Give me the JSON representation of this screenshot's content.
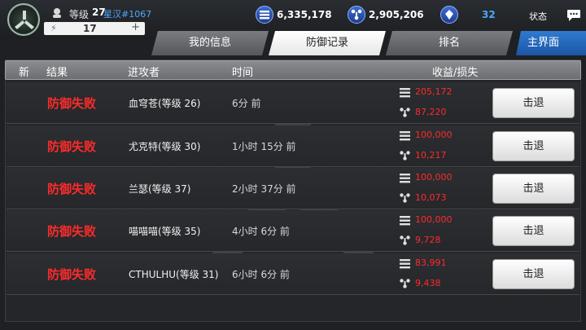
{
  "player": {
    "level_label": "等级",
    "level": "27",
    "server": "星汉#1067",
    "xp_value": "17",
    "xp_plus": "+"
  },
  "resources": [
    {
      "icon": "layers-icon",
      "value": "6,335,178"
    },
    {
      "icon": "molecule-icon",
      "value": "2,905,206"
    },
    {
      "icon": "crystal-icon",
      "value": "32"
    }
  ],
  "top_right": {
    "status_label": "状态"
  },
  "tabs": [
    {
      "label": "我的信息",
      "active": false
    },
    {
      "label": "防御记录",
      "active": true
    },
    {
      "label": "排名",
      "active": false
    }
  ],
  "main_button": "主界面",
  "table": {
    "headers": {
      "new": "新",
      "result": "结果",
      "attacker": "进攻者",
      "time": "时间",
      "gain_loss": "收益/损失"
    },
    "rows": [
      {
        "result": "防御失败",
        "attacker": "血穹苍(等级 26)",
        "time": "6分 前",
        "loss1": "205,172",
        "loss2": "87,220",
        "button": "击退"
      },
      {
        "result": "防御失败",
        "attacker": "尤克特(等级 30)",
        "time": "1小时 15分 前",
        "loss1": "100,000",
        "loss2": "10,217",
        "button": "击退"
      },
      {
        "result": "防御失败",
        "attacker": "兰瑟(等级 37)",
        "time": "2小时 37分 前",
        "loss1": "100,000",
        "loss2": "10,073",
        "button": "击退"
      },
      {
        "result": "防御失败",
        "attacker": "喵喵喵(等级 35)",
        "time": "4小时 6分 前",
        "loss1": "100,000",
        "loss2": "9,728",
        "button": "击退"
      },
      {
        "result": "防御失败",
        "attacker": "CTHULHU(等级 31)",
        "time": "6小时 6分 前",
        "loss1": "83,991",
        "loss2": "9,438",
        "button": "击退"
      }
    ]
  },
  "colors": {
    "loss_red": "#ff2a2a",
    "accent_blue": "#4aa8ff",
    "main_button_blue": "#1c56a4"
  }
}
